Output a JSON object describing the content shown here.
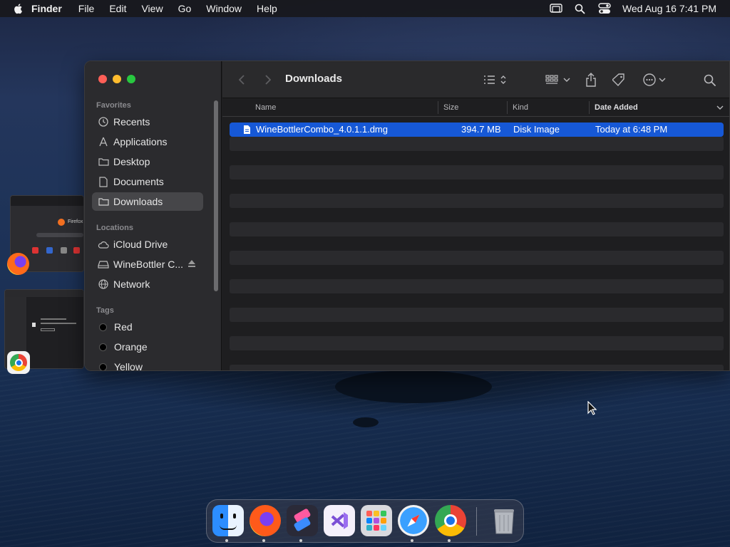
{
  "menubar": {
    "app_name": "Finder",
    "menus": [
      "File",
      "Edit",
      "View",
      "Go",
      "Window",
      "Help"
    ],
    "clock": "Wed Aug 16  7:41 PM",
    "status_icons": [
      "screen-mirroring-icon",
      "spotlight-search-icon",
      "control-center-icon"
    ]
  },
  "window": {
    "title": "Downloads",
    "sidebar": {
      "favorites_label": "Favorites",
      "favorites": [
        {
          "label": "Recents",
          "icon": "clock-icon"
        },
        {
          "label": "Applications",
          "icon": "applications-icon"
        },
        {
          "label": "Desktop",
          "icon": "folder-icon"
        },
        {
          "label": "Documents",
          "icon": "document-icon"
        },
        {
          "label": "Downloads",
          "icon": "folder-icon",
          "selected": true
        }
      ],
      "locations_label": "Locations",
      "locations": [
        {
          "label": "iCloud Drive",
          "icon": "cloud-icon"
        },
        {
          "label": "WineBottler C...",
          "icon": "disk-icon",
          "eject": true
        },
        {
          "label": "Network",
          "icon": "globe-icon"
        }
      ],
      "tags_label": "Tags",
      "tags": [
        {
          "label": "Red"
        },
        {
          "label": "Orange"
        },
        {
          "label": "Yellow"
        }
      ]
    },
    "columns": {
      "name": "Name",
      "size": "Size",
      "kind": "Kind",
      "date_added": "Date Added"
    },
    "files": [
      {
        "name": "WineBottlerCombo_4.0.1.1.dmg",
        "size": "394.7 MB",
        "kind": "Disk Image",
        "date_added": "Today at 6:48 PM",
        "selected": true
      }
    ]
  },
  "stacked_windows": {
    "top_label": "Firefox"
  },
  "dock": {
    "apps": [
      "Finder",
      "Firefox",
      "Shortcuts",
      "Visual Studio",
      "Launchpad",
      "Safari",
      "Chrome",
      "Trash"
    ]
  },
  "colors": {
    "selection": "#1658d6",
    "accent_close": "#ff5f57",
    "accent_min": "#febc2e",
    "accent_max": "#28c840"
  }
}
